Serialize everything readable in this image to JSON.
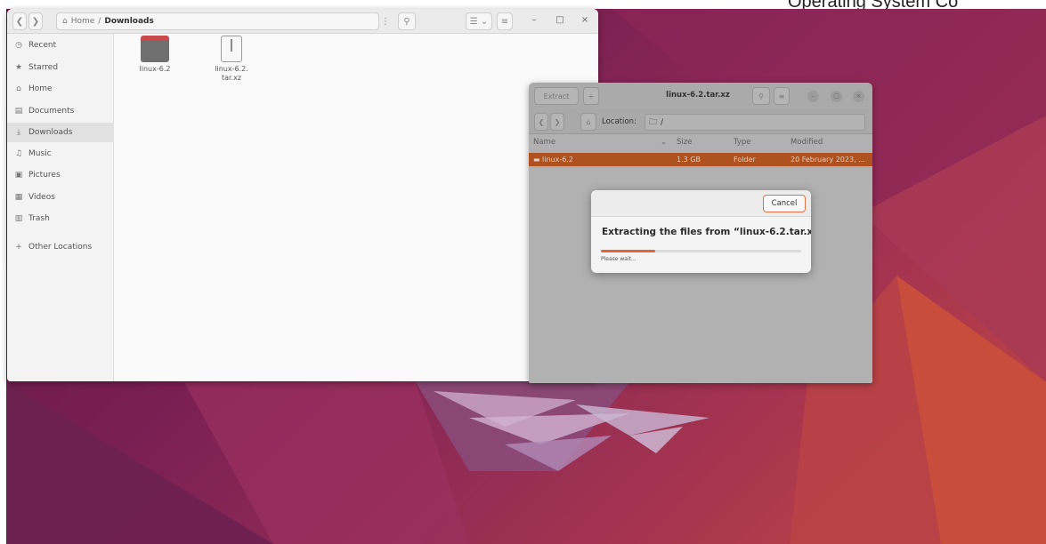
{
  "top_banner": "Operating System Co",
  "files_window": {
    "breadcrumb": {
      "home": "Home",
      "separator": "/",
      "current": "Downloads"
    },
    "sidebar": [
      {
        "icon": "clock-icon",
        "glyph": "◷",
        "label": "Recent"
      },
      {
        "icon": "star-icon",
        "glyph": "★",
        "label": "Starred"
      },
      {
        "icon": "home-icon",
        "glyph": "⌂",
        "label": "Home"
      },
      {
        "icon": "document-icon",
        "glyph": "▤",
        "label": "Documents"
      },
      {
        "icon": "download-icon",
        "glyph": "⤓",
        "label": "Downloads",
        "active": true
      },
      {
        "icon": "music-icon",
        "glyph": "♫",
        "label": "Music"
      },
      {
        "icon": "picture-icon",
        "glyph": "▣",
        "label": "Pictures"
      },
      {
        "icon": "video-icon",
        "glyph": "▦",
        "label": "Videos"
      },
      {
        "icon": "trash-icon",
        "glyph": "▥",
        "label": "Trash"
      },
      {
        "icon": "plus-icon",
        "glyph": "+",
        "label": "Other Locations"
      }
    ],
    "files": [
      {
        "name": "linux-6.2",
        "type": "folder"
      },
      {
        "name_line1": "linux-6.2.",
        "name_line2": "tar.xz",
        "type": "archive"
      }
    ]
  },
  "archive_window": {
    "title": "linux-6.2.tar.xz",
    "extract_label": "Extract",
    "add_label": "+",
    "location_label": "Location:",
    "location_path": "/",
    "columns": [
      "Name",
      "Size",
      "Type",
      "Modified"
    ],
    "rows": [
      {
        "name": "linux-6.2",
        "size": "1.3 GB",
        "type": "Folder",
        "modified": "20 February 2023, ..."
      }
    ]
  },
  "dialog": {
    "cancel_label": "Cancel",
    "title": "Extracting the files from “linux-6.2.tar.xz”",
    "status": "Please wait...",
    "progress": 0.27
  },
  "colors": {
    "accent": "#e0653a",
    "selection": "#b0521f",
    "desktop": "#7a1f52"
  }
}
